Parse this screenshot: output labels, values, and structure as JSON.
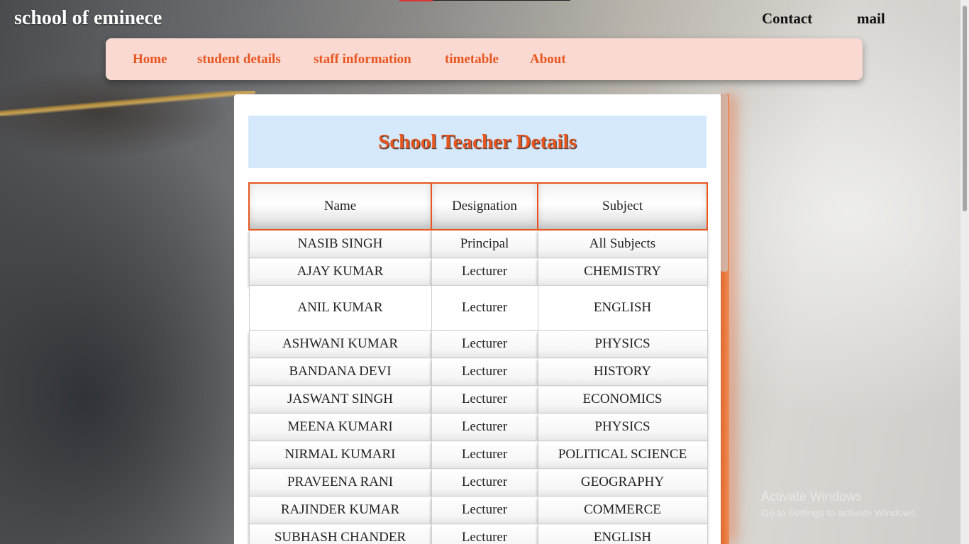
{
  "header": {
    "brand": "school of eminece",
    "contact": "Contact",
    "mail": "mail"
  },
  "nav": {
    "items": [
      "Home",
      "student details",
      "staff information",
      "timetable",
      "About"
    ]
  },
  "main": {
    "title": "School Teacher Details",
    "table": {
      "columns": [
        "Name",
        "Designation",
        "Subject"
      ],
      "rows": [
        [
          "NASIB SINGH",
          "Principal",
          "All Subjects"
        ],
        [
          "AJAY KUMAR",
          "Lecturer",
          "CHEMISTRY"
        ],
        [
          "ANIL KUMAR",
          "Lecturer",
          "ENGLISH"
        ],
        [
          "ASHWANI KUMAR",
          "Lecturer",
          "PHYSICS"
        ],
        [
          "BANDANA DEVI",
          "Lecturer",
          "HISTORY"
        ],
        [
          "JASWANT SINGH",
          "Lecturer",
          "ECONOMICS"
        ],
        [
          "MEENA KUMARI",
          "Lecturer",
          "PHYSICS"
        ],
        [
          "NIRMAL KUMARI",
          "Lecturer",
          "POLITICAL SCIENCE"
        ],
        [
          "PRAVEENA RANI",
          "Lecturer",
          "GEOGRAPHY"
        ],
        [
          "RAJINDER KUMAR",
          "Lecturer",
          "COMMERCE"
        ],
        [
          "SUBHASH CHANDER",
          "Lecturer",
          "ENGLISH"
        ]
      ],
      "highlighted_row": 2
    }
  },
  "watermark": {
    "line1": "Activate Windows",
    "line2": "Go to Settings to activate Windows."
  },
  "colors": {
    "accent": "#e8561f",
    "nav_bg": "#fad9d2",
    "title_bg": "#d6e8fb"
  }
}
